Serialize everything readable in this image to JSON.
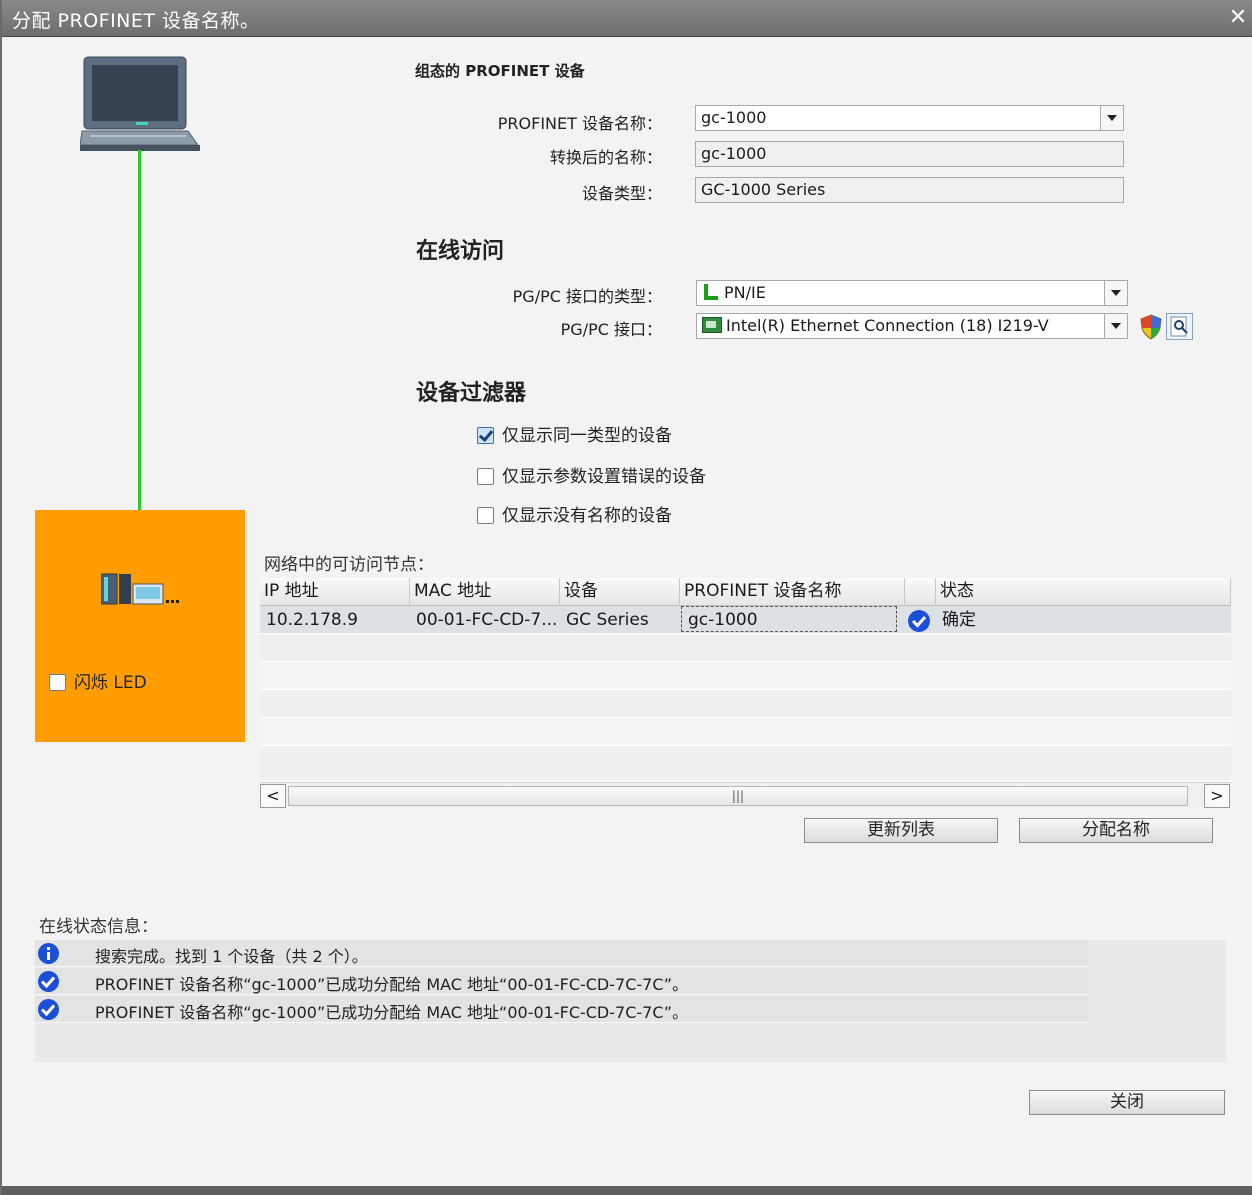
{
  "window": {
    "title": "分配 PROFINET 设备名称。",
    "close_symbol": "✕"
  },
  "configured": {
    "heading": "组态的 PROFINET 设备",
    "name_label": "PROFINET 设备名称：",
    "name_value": "gc-1000",
    "converted_label": "转换后的名称：",
    "converted_value": "gc-1000",
    "type_label": "设备类型：",
    "type_value": "GC-1000 Series"
  },
  "online_access": {
    "heading": "在线访问",
    "iface_type_label": "PG/PC 接口的类型：",
    "iface_type_value": "PN/IE",
    "iface_label": "PG/PC 接口：",
    "iface_value": "Intel(R) Ethernet Connection (18) I219-V"
  },
  "filter": {
    "heading": "设备过滤器",
    "options": [
      {
        "label": "仅显示同一类型的设备",
        "checked": true
      },
      {
        "label": "仅显示参数设置错误的设备",
        "checked": false
      },
      {
        "label": "仅显示没有名称的设备",
        "checked": false
      }
    ]
  },
  "flash_led": {
    "label": "闪烁 LED",
    "checked": false
  },
  "nodes": {
    "heading": "网络中的可访问节点：",
    "columns": [
      "IP 地址",
      "MAC 地址",
      "设备",
      "PROFINET 设备名称",
      "",
      "状态"
    ],
    "rows": [
      {
        "ip": "10.2.178.9",
        "mac": "00-01-FC-CD-7...",
        "device": "GC Series",
        "name": "gc-1000",
        "status": "确定"
      }
    ],
    "scroll_left": "<",
    "scroll_right": ">",
    "scroll_grip": "|||"
  },
  "buttons": {
    "refresh": "更新列表",
    "assign": "分配名称",
    "close": "关闭"
  },
  "status": {
    "heading": "在线状态信息：",
    "messages": [
      {
        "icon": "info-icon",
        "text": "搜索完成。找到 1 个设备（共 2 个）。"
      },
      {
        "icon": "check-icon",
        "text": "PROFINET 设备名称“gc-1000”已成功分配给 MAC 地址“00-01-FC-CD-7C-7C”。"
      },
      {
        "icon": "check-icon",
        "text": "PROFINET 设备名称“gc-1000”已成功分配给 MAC 地址“00-01-FC-CD-7C-7C”。"
      }
    ]
  },
  "colors": {
    "accent_orange": "#ff9c00",
    "link_green": "#2fc92f",
    "check_blue": "#1c4fd8"
  }
}
